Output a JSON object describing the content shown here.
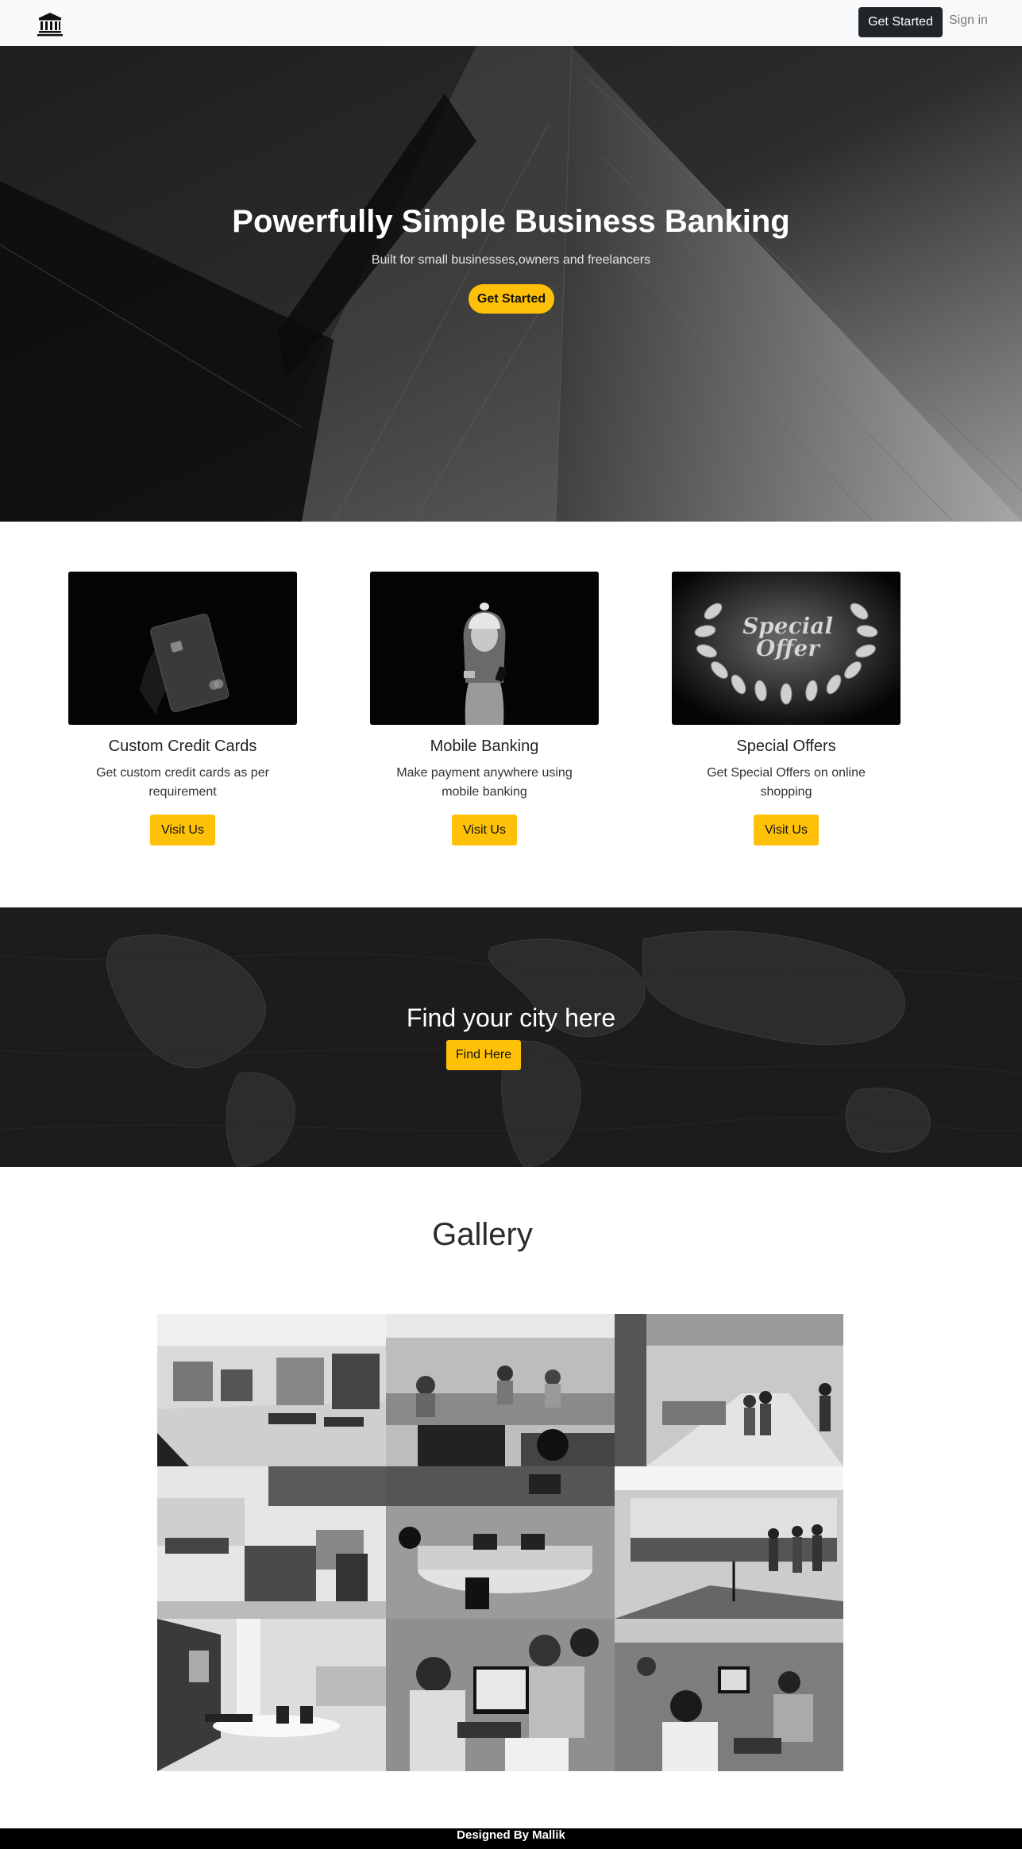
{
  "nav": {
    "cta_label": "Get Started",
    "signin_label": "Sign in",
    "logo_icon": "bank-icon"
  },
  "hero": {
    "title": "Powerfully Simple Business Banking",
    "subtitle": "Built for small businesses,owners and freelancers",
    "cta_label": "Get Started"
  },
  "cards": [
    {
      "title": "Custom Credit Cards",
      "text": "Get custom credit cards as per requirement",
      "button": "Visit Us",
      "image_icon": "credit-card-icon"
    },
    {
      "title": "Mobile Banking",
      "text": "Make payment anywhere using mobile banking",
      "button": "Visit Us",
      "image_icon": "mobile-user-icon"
    },
    {
      "title": "Special Offers",
      "text": "Get Special Offers on online shopping",
      "button": "Visit Us",
      "image_icon": "special-offer-wreath-icon",
      "image_text": [
        "Special",
        "Offer"
      ]
    }
  ],
  "city": {
    "title": "Find your city here",
    "button": "Find Here"
  },
  "gallery": {
    "title": "Gallery",
    "image_count": 9
  },
  "footer": {
    "text": "Designed By Mallik"
  },
  "colors": {
    "accent": "#ffc107",
    "dark": "#212529",
    "navbar_bg": "#f8f9fa",
    "footer_bg": "#000000"
  }
}
